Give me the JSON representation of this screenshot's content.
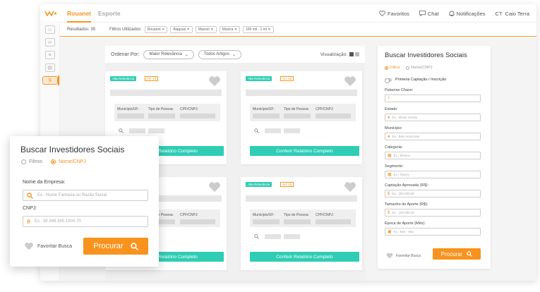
{
  "brand": {
    "accent": "#f7931e",
    "teal": "#2fcdb4",
    "logo": "wn-logo-icon"
  },
  "tabs": [
    {
      "label": "Rouanet"
    },
    {
      "label": "Esporte"
    }
  ],
  "topnav": {
    "favoritos": "Favoritos",
    "chat": "Chat",
    "notificacoes": "Notificações",
    "user_initials": "CT",
    "user_name": "Caio Terra"
  },
  "filters": {
    "results_label": "Resultados: 35",
    "used_label": "Filtros Utilizados:",
    "chips": [
      "Rouanet ✕",
      "Alagoas ✕",
      "Maceió ✕",
      "Música ✕",
      "100 mil - 1 mi ✕"
    ]
  },
  "sortbar": {
    "order_label": "Ordenar Por:",
    "order_value": "Maior Relevância",
    "articles_value": "Todos Artigos",
    "viz_label": "Visualização:"
  },
  "card": {
    "badge": "Alta Relevância",
    "article": "Art. 18",
    "col1": "Município/UF:",
    "col2": "Tipo de Pessoa:",
    "col3": "CPF/CNPJ:",
    "button": "Conferir Relatório Completo"
  },
  "right_panel": {
    "title": "Buscar Investidores Sociais",
    "radio_filtros": "Filtros",
    "radio_nome": "Nome/CNPJ",
    "toggle": "Primeira Captação / Inscrição",
    "fields": [
      {
        "label": "Palavras Chave:",
        "placeholder": "",
        "icon": "search-icon"
      },
      {
        "label": "Estado:",
        "placeholder": "Ex.: Minas Gerais",
        "icon": "pin-icon"
      },
      {
        "label": "Município:",
        "placeholder": "Ex.: Belo Horizonte",
        "icon": "pin-icon"
      },
      {
        "label": "Categoria:",
        "placeholder": "Ex.: Música",
        "icon": "grid-icon"
      },
      {
        "label": "Segmento:",
        "placeholder": "Ex.: Ópera",
        "icon": "grid-icon"
      },
      {
        "label": "Captação Aprovada (R$):",
        "placeholder": "Ex.: 300.000,00",
        "icon": "dollar-icon"
      },
      {
        "label": "Tamanho do Aporte (R$):",
        "placeholder": "Ex.: 100.000,00",
        "icon": "dollar-icon"
      },
      {
        "label": "Época de Aporte (Mês):",
        "placeholder": "Ex.: Mar - Mai",
        "icon": "calendar-icon"
      }
    ],
    "favorite": "Favoritar Busca",
    "search_button": "Procurar"
  },
  "floating_panel": {
    "title": "Buscar Investidores Sociais",
    "radio_filtros": "Filtros",
    "radio_nome": "Nome/CNPJ",
    "company_label": "Nome da Empresa:",
    "company_placeholder": "Ex.: Nome Fantasia ou Razão Social",
    "cnpj_label": "CNPJ:",
    "cnpj_placeholder": "Ex.: 30.349.345.1000-70",
    "favorite": "Favoritar Busca",
    "search_button": "Procurar"
  }
}
